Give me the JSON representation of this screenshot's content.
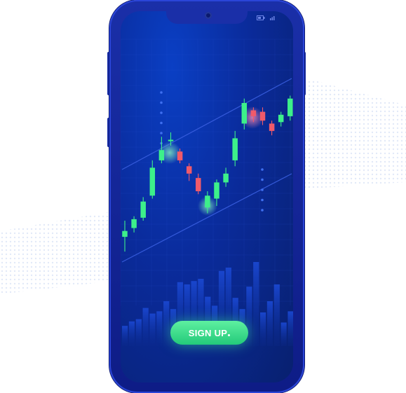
{
  "device": {
    "frame_color": "#1a2fa8",
    "screen_color": "#0a2b9b"
  },
  "status_bar": {
    "icons": [
      "battery-icon",
      "signal-icon"
    ]
  },
  "chart": {
    "bullish_color": "#3df08a",
    "bearish_color": "#f05a6a",
    "channel_color": "#3a5fe0",
    "candles": [
      {
        "open": 19,
        "close": 23,
        "high": 30,
        "low": 9,
        "dir": "up"
      },
      {
        "open": 25,
        "close": 31,
        "high": 33,
        "low": 22,
        "dir": "up"
      },
      {
        "open": 32,
        "close": 43,
        "high": 46,
        "low": 30,
        "dir": "up"
      },
      {
        "open": 47,
        "close": 66,
        "high": 71,
        "low": 45,
        "dir": "up"
      },
      {
        "open": 71,
        "close": 78,
        "high": 87,
        "low": 69,
        "dir": "up"
      },
      {
        "open": 84,
        "close": 85,
        "high": 90,
        "low": 81,
        "dir": "up"
      },
      {
        "open": 77,
        "close": 71,
        "high": 79,
        "low": 69,
        "dir": "down"
      },
      {
        "open": 67,
        "close": 62,
        "high": 69,
        "low": 57,
        "dir": "down"
      },
      {
        "open": 59,
        "close": 50,
        "high": 62,
        "low": 48,
        "dir": "down"
      },
      {
        "open": 39,
        "close": 47,
        "high": 50,
        "low": 35,
        "dir": "up"
      },
      {
        "open": 45,
        "close": 56,
        "high": 58,
        "low": 40,
        "dir": "up"
      },
      {
        "open": 56,
        "close": 62,
        "high": 66,
        "low": 53,
        "dir": "up"
      },
      {
        "open": 71,
        "close": 86,
        "high": 91,
        "low": 67,
        "dir": "up"
      },
      {
        "open": 96,
        "close": 110,
        "high": 113,
        "low": 92,
        "dir": "up"
      },
      {
        "open": 101,
        "close": 105,
        "high": 107,
        "low": 97,
        "dir": "down"
      },
      {
        "open": 104,
        "close": 98,
        "high": 107,
        "low": 95,
        "dir": "down"
      },
      {
        "open": 96,
        "close": 91,
        "high": 98,
        "low": 88,
        "dir": "down"
      },
      {
        "open": 97,
        "close": 102,
        "high": 104,
        "low": 94,
        "dir": "up"
      },
      {
        "open": 101,
        "close": 113,
        "high": 115,
        "low": 98,
        "dir": "up"
      }
    ],
    "volume_bars": [
      18,
      22,
      24,
      34,
      29,
      31,
      40,
      33,
      57,
      55,
      58,
      60,
      44,
      36,
      67,
      70,
      43,
      33,
      53,
      75,
      30,
      40,
      55,
      21,
      31
    ]
  },
  "cta": {
    "label": "SIGN UP",
    "accent": "#3df08a"
  }
}
